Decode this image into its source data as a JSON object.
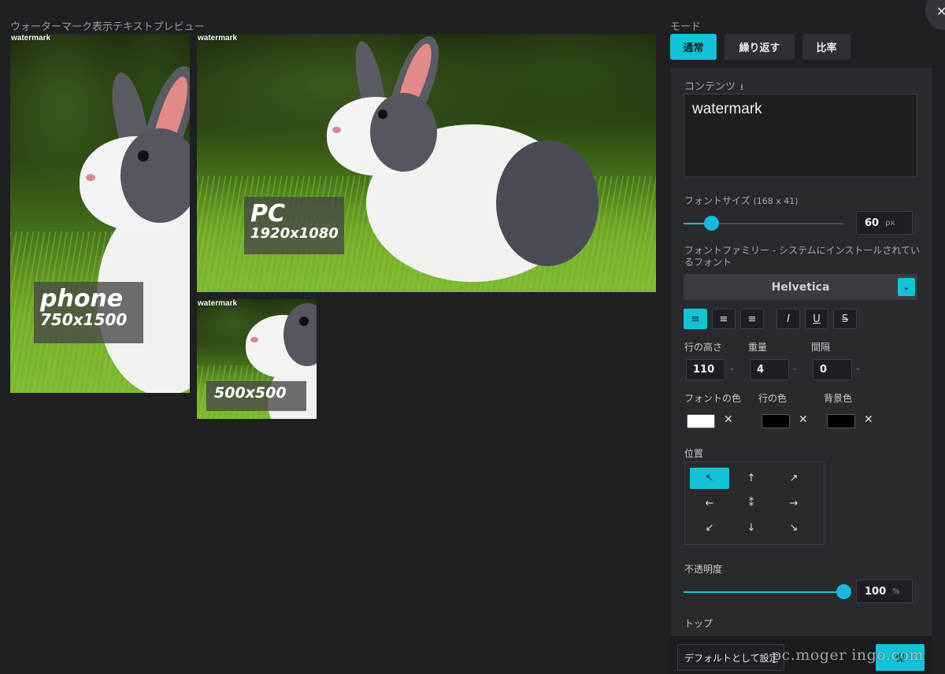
{
  "preview": {
    "title": "ウォーターマーク表示テキストプレビュー",
    "watermark_text": "watermark",
    "phone": {
      "name": "phone",
      "size": "750x1500"
    },
    "pc": {
      "name": "PC",
      "size": "1920x1080"
    },
    "square": {
      "size": "500x500"
    }
  },
  "mode": {
    "label": "モード",
    "buttons": [
      "通常",
      "繰り返す",
      "比率"
    ],
    "active": "通常"
  },
  "close_icon": "✕",
  "content": {
    "label": "コンテンツ",
    "download_icon": "⭳",
    "value": "watermark"
  },
  "font_size": {
    "label": "フォントサイズ",
    "dims": "(168 x 41)",
    "value": "60",
    "unit": "px"
  },
  "font_family": {
    "label": "フォントファミリー - システムにインストールされているフォント",
    "value": "Helvetica",
    "chevron": "⌄"
  },
  "format_buttons": {
    "align_left": "≡",
    "align_center": "≡",
    "align_right": "≡",
    "italic": "I",
    "underline": "U",
    "strike": "S"
  },
  "spacing": {
    "line_height_label": "行の高さ",
    "line_height": "110",
    "weight_label": "重量",
    "weight": "4",
    "gap_label": "間隔",
    "gap": "0",
    "chevron": "⌄"
  },
  "colors": {
    "font_color_label": "フォントの色",
    "line_color_label": "行の色",
    "bg_color_label": "背景色",
    "font_color": "#ffffff",
    "line_color": "#000000",
    "bg_color": "#000000",
    "clear": "✕"
  },
  "position": {
    "label": "位置",
    "arrows": [
      "↖",
      "↑",
      "↗",
      "←",
      "⁑",
      "→",
      "↙",
      "↓",
      "↘"
    ],
    "active_index": 0
  },
  "opacity": {
    "label": "不透明度",
    "value": "100",
    "unit": "%",
    "level": 1.0
  },
  "top": {
    "label": "トップ"
  },
  "footer": {
    "default_button": "デフォルトとして設定",
    "save_button": "保",
    "credit": "pc.moger ingo.com"
  },
  "accent_color": "#13c2d6"
}
